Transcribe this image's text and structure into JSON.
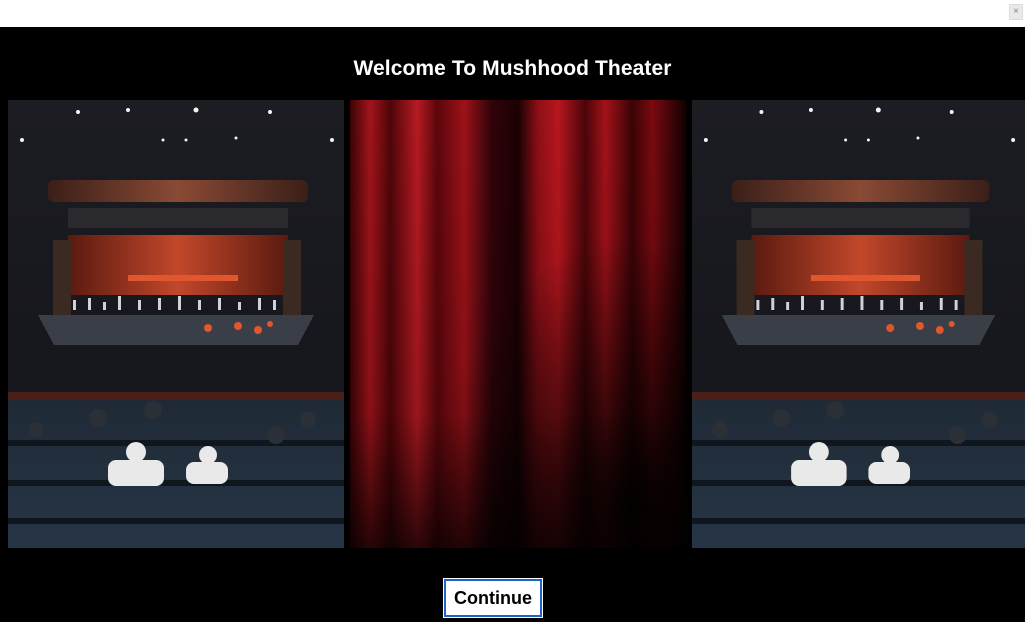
{
  "window": {
    "close_glyph": "×"
  },
  "page": {
    "title": "Welcome To Mushhood Theater"
  },
  "images": {
    "left": "concert-hall-photo",
    "center": "red-curtain-photo",
    "right": "concert-hall-photo"
  },
  "actions": {
    "continue_label": "Continue"
  },
  "colors": {
    "background": "#000000",
    "curtain": "#8b0a0f",
    "button_border": "#1e63c8"
  }
}
